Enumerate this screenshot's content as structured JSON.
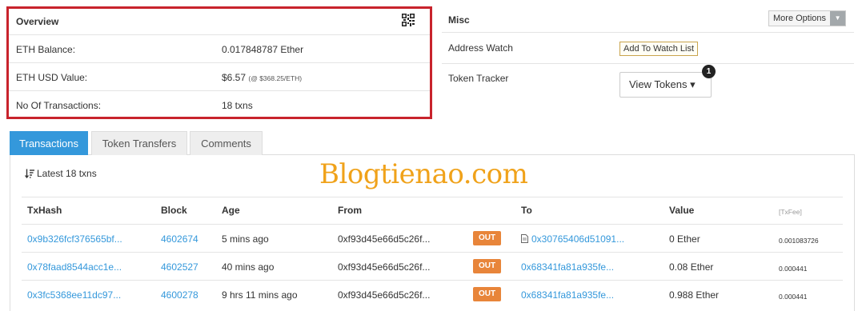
{
  "overview": {
    "title": "Overview",
    "rows": [
      {
        "label": "ETH Balance:",
        "value": "0.017848787 Ether",
        "note": ""
      },
      {
        "label": "ETH USD Value:",
        "value": "$6.57",
        "note": "(@ $368.25/ETH)"
      },
      {
        "label": "No Of Transactions:",
        "value": "18 txns",
        "note": ""
      }
    ],
    "highlight_color": "#c8232c"
  },
  "misc": {
    "title": "Misc",
    "more_options_label": "More Options",
    "address_watch_label": "Address Watch",
    "add_watch_button": "Add To Watch List",
    "token_tracker_label": "Token Tracker",
    "view_tokens_button": "View Tokens ▾",
    "badge": "1"
  },
  "tabs": [
    {
      "label": "Transactions",
      "active": true
    },
    {
      "label": "Token Transfers",
      "active": false
    },
    {
      "label": "Comments",
      "active": false
    }
  ],
  "transactions": {
    "summary": "Latest 18 txns",
    "watermark": "Blogtienao.com",
    "headers": {
      "hash": "TxHash",
      "block": "Block",
      "age": "Age",
      "from": "From",
      "to": "To",
      "value": "Value",
      "fee": "[TxFee]"
    },
    "rows": [
      {
        "hash": "0x9b326fcf376565bf...",
        "block": "4602674",
        "age": "5 mins ago",
        "from": "0xf93d45e66d5c26f...",
        "direction": "OUT",
        "to": "0x30765406d51091...",
        "to_is_contract": true,
        "value": "0 Ether",
        "fee": "0.001083726"
      },
      {
        "hash": "0x78faad8544acc1e...",
        "block": "4602527",
        "age": "40 mins ago",
        "from": "0xf93d45e66d5c26f...",
        "direction": "OUT",
        "to": "0x68341fa81a935fe...",
        "to_is_contract": false,
        "value": "0.08 Ether",
        "fee": "0.000441"
      },
      {
        "hash": "0x3fc5368ee11dc97...",
        "block": "4600278",
        "age": "9 hrs 11 mins ago",
        "from": "0xf93d45e66d5c26f...",
        "direction": "OUT",
        "to": "0x68341fa81a935fe...",
        "to_is_contract": false,
        "value": "0.988 Ether",
        "fee": "0.000441"
      }
    ]
  },
  "colors": {
    "accent": "#3498db",
    "out_badge": "#e8853a",
    "watermark": "#f0a21a"
  }
}
